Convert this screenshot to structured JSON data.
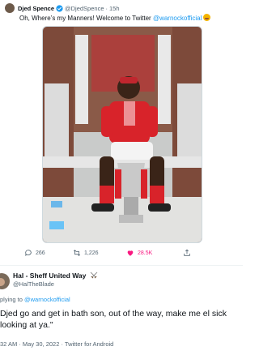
{
  "top_tweet": {
    "name": "Djed Spence",
    "handle": "@DjedSpence",
    "separator": "·",
    "age": "15h",
    "text_before": "Oh, Where’s my Manners! Welcome to Twitter ",
    "mention": "@warnockofficial",
    "emoji_icon": "smiling-face-icon",
    "actions": {
      "replies": "266",
      "retweets": "1,226",
      "likes": "28.5K"
    },
    "colors": {
      "like": "#f91880",
      "link": "#1d9bf0",
      "muted": "#536471"
    }
  },
  "reply_tweet": {
    "name": "Hal - Sheff United Way",
    "name_emoji_icon": "crossed-swords-icon",
    "handle": "@HalTheBlade",
    "replying_prefix": "plying to ",
    "replying_to": "@warnockofficial",
    "text": "Djed go and get in bath son, out of the way, make me el sick looking at ya.\"",
    "meta": "32 AM · May 30, 2022 · Twitter for Android"
  }
}
